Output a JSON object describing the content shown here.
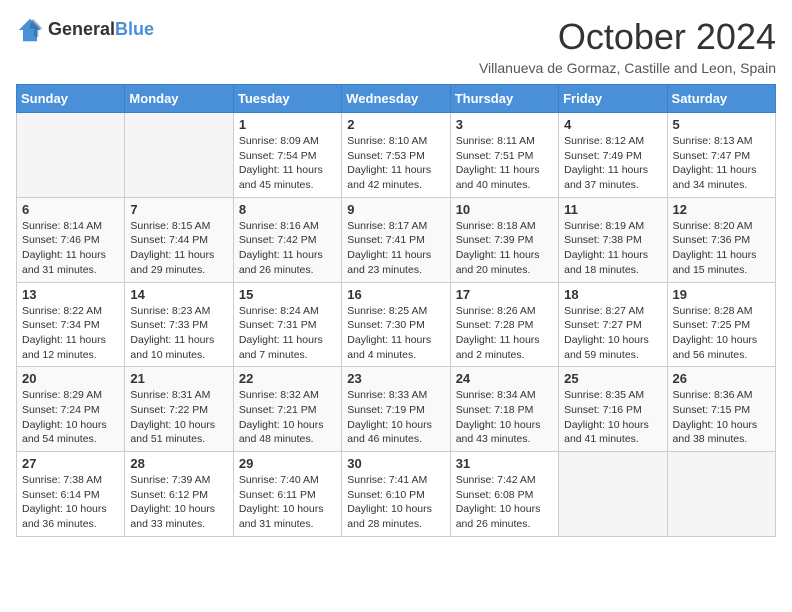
{
  "logo": {
    "line1": "General",
    "line2": "Blue"
  },
  "title": "October 2024",
  "subtitle": "Villanueva de Gormaz, Castille and Leon, Spain",
  "headers": [
    "Sunday",
    "Monday",
    "Tuesday",
    "Wednesday",
    "Thursday",
    "Friday",
    "Saturday"
  ],
  "weeks": [
    [
      {
        "day": "",
        "info": ""
      },
      {
        "day": "",
        "info": ""
      },
      {
        "day": "1",
        "info": "Sunrise: 8:09 AM\nSunset: 7:54 PM\nDaylight: 11 hours and 45 minutes."
      },
      {
        "day": "2",
        "info": "Sunrise: 8:10 AM\nSunset: 7:53 PM\nDaylight: 11 hours and 42 minutes."
      },
      {
        "day": "3",
        "info": "Sunrise: 8:11 AM\nSunset: 7:51 PM\nDaylight: 11 hours and 40 minutes."
      },
      {
        "day": "4",
        "info": "Sunrise: 8:12 AM\nSunset: 7:49 PM\nDaylight: 11 hours and 37 minutes."
      },
      {
        "day": "5",
        "info": "Sunrise: 8:13 AM\nSunset: 7:47 PM\nDaylight: 11 hours and 34 minutes."
      }
    ],
    [
      {
        "day": "6",
        "info": "Sunrise: 8:14 AM\nSunset: 7:46 PM\nDaylight: 11 hours and 31 minutes."
      },
      {
        "day": "7",
        "info": "Sunrise: 8:15 AM\nSunset: 7:44 PM\nDaylight: 11 hours and 29 minutes."
      },
      {
        "day": "8",
        "info": "Sunrise: 8:16 AM\nSunset: 7:42 PM\nDaylight: 11 hours and 26 minutes."
      },
      {
        "day": "9",
        "info": "Sunrise: 8:17 AM\nSunset: 7:41 PM\nDaylight: 11 hours and 23 minutes."
      },
      {
        "day": "10",
        "info": "Sunrise: 8:18 AM\nSunset: 7:39 PM\nDaylight: 11 hours and 20 minutes."
      },
      {
        "day": "11",
        "info": "Sunrise: 8:19 AM\nSunset: 7:38 PM\nDaylight: 11 hours and 18 minutes."
      },
      {
        "day": "12",
        "info": "Sunrise: 8:20 AM\nSunset: 7:36 PM\nDaylight: 11 hours and 15 minutes."
      }
    ],
    [
      {
        "day": "13",
        "info": "Sunrise: 8:22 AM\nSunset: 7:34 PM\nDaylight: 11 hours and 12 minutes."
      },
      {
        "day": "14",
        "info": "Sunrise: 8:23 AM\nSunset: 7:33 PM\nDaylight: 11 hours and 10 minutes."
      },
      {
        "day": "15",
        "info": "Sunrise: 8:24 AM\nSunset: 7:31 PM\nDaylight: 11 hours and 7 minutes."
      },
      {
        "day": "16",
        "info": "Sunrise: 8:25 AM\nSunset: 7:30 PM\nDaylight: 11 hours and 4 minutes."
      },
      {
        "day": "17",
        "info": "Sunrise: 8:26 AM\nSunset: 7:28 PM\nDaylight: 11 hours and 2 minutes."
      },
      {
        "day": "18",
        "info": "Sunrise: 8:27 AM\nSunset: 7:27 PM\nDaylight: 10 hours and 59 minutes."
      },
      {
        "day": "19",
        "info": "Sunrise: 8:28 AM\nSunset: 7:25 PM\nDaylight: 10 hours and 56 minutes."
      }
    ],
    [
      {
        "day": "20",
        "info": "Sunrise: 8:29 AM\nSunset: 7:24 PM\nDaylight: 10 hours and 54 minutes."
      },
      {
        "day": "21",
        "info": "Sunrise: 8:31 AM\nSunset: 7:22 PM\nDaylight: 10 hours and 51 minutes."
      },
      {
        "day": "22",
        "info": "Sunrise: 8:32 AM\nSunset: 7:21 PM\nDaylight: 10 hours and 48 minutes."
      },
      {
        "day": "23",
        "info": "Sunrise: 8:33 AM\nSunset: 7:19 PM\nDaylight: 10 hours and 46 minutes."
      },
      {
        "day": "24",
        "info": "Sunrise: 8:34 AM\nSunset: 7:18 PM\nDaylight: 10 hours and 43 minutes."
      },
      {
        "day": "25",
        "info": "Sunrise: 8:35 AM\nSunset: 7:16 PM\nDaylight: 10 hours and 41 minutes."
      },
      {
        "day": "26",
        "info": "Sunrise: 8:36 AM\nSunset: 7:15 PM\nDaylight: 10 hours and 38 minutes."
      }
    ],
    [
      {
        "day": "27",
        "info": "Sunrise: 7:38 AM\nSunset: 6:14 PM\nDaylight: 10 hours and 36 minutes."
      },
      {
        "day": "28",
        "info": "Sunrise: 7:39 AM\nSunset: 6:12 PM\nDaylight: 10 hours and 33 minutes."
      },
      {
        "day": "29",
        "info": "Sunrise: 7:40 AM\nSunset: 6:11 PM\nDaylight: 10 hours and 31 minutes."
      },
      {
        "day": "30",
        "info": "Sunrise: 7:41 AM\nSunset: 6:10 PM\nDaylight: 10 hours and 28 minutes."
      },
      {
        "day": "31",
        "info": "Sunrise: 7:42 AM\nSunset: 6:08 PM\nDaylight: 10 hours and 26 minutes."
      },
      {
        "day": "",
        "info": ""
      },
      {
        "day": "",
        "info": ""
      }
    ]
  ]
}
